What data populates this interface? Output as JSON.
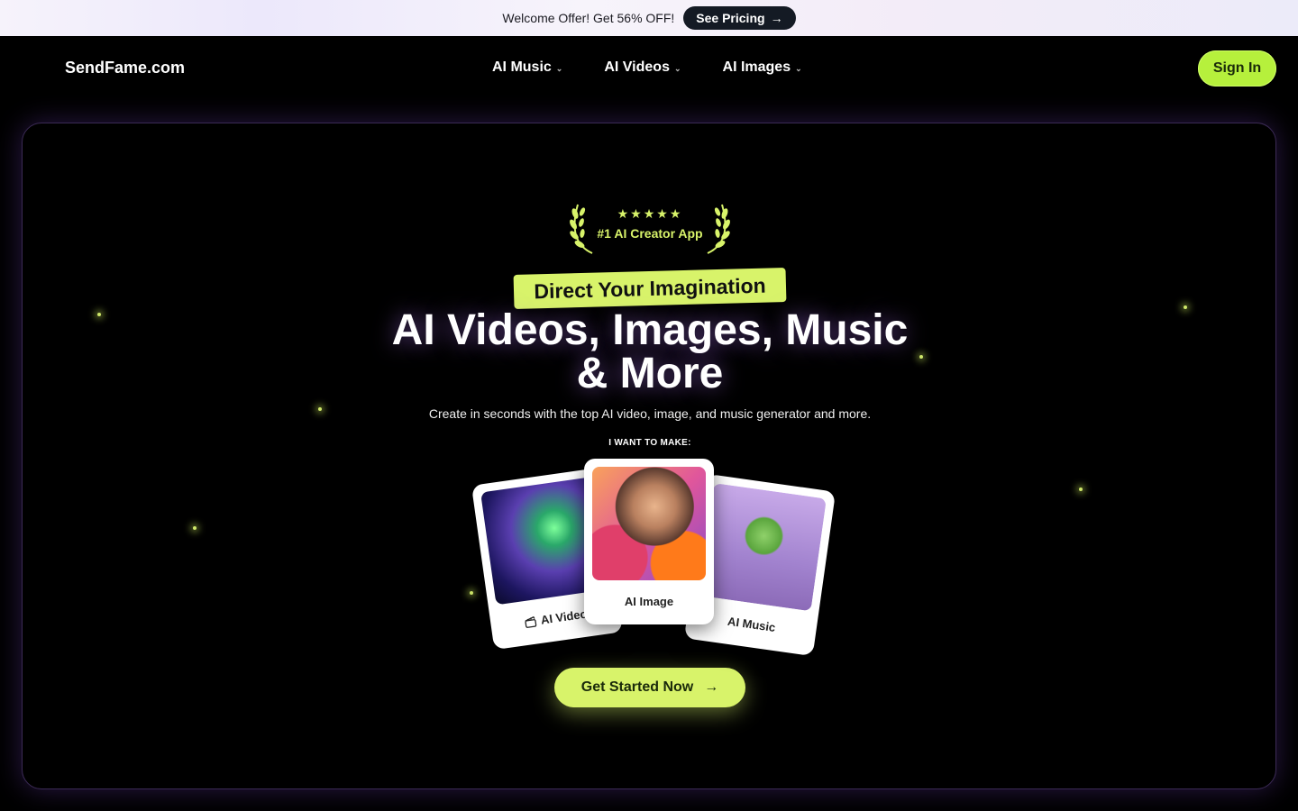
{
  "promo": {
    "text": "Welcome Offer! Get 56% OFF!",
    "button_label": "See Pricing"
  },
  "nav": {
    "logo": "SendFame.com",
    "menu": [
      {
        "label": "AI Music"
      },
      {
        "label": "AI Videos"
      },
      {
        "label": "AI Images"
      }
    ],
    "signin_label": "Sign In"
  },
  "hero": {
    "rating_stars": "★★★★★",
    "award_text": "#1 AI Creator App",
    "tagline": "Direct Your Imagination",
    "headline_line1": "AI Videos, Images, Music",
    "headline_line2": "& More",
    "subtitle": "Create in seconds with the top AI video, image, and music generator and more.",
    "make_label": "I WANT TO MAKE:",
    "cards": [
      {
        "label": "AI Video"
      },
      {
        "label": "AI Image"
      },
      {
        "label": "AI Music"
      }
    ],
    "cta_label": "Get Started Now"
  },
  "colors": {
    "accent": "#d8f36a",
    "signin": "#b6f03c",
    "promo_button": "#141a24",
    "hero_border": "#3b2a55"
  }
}
